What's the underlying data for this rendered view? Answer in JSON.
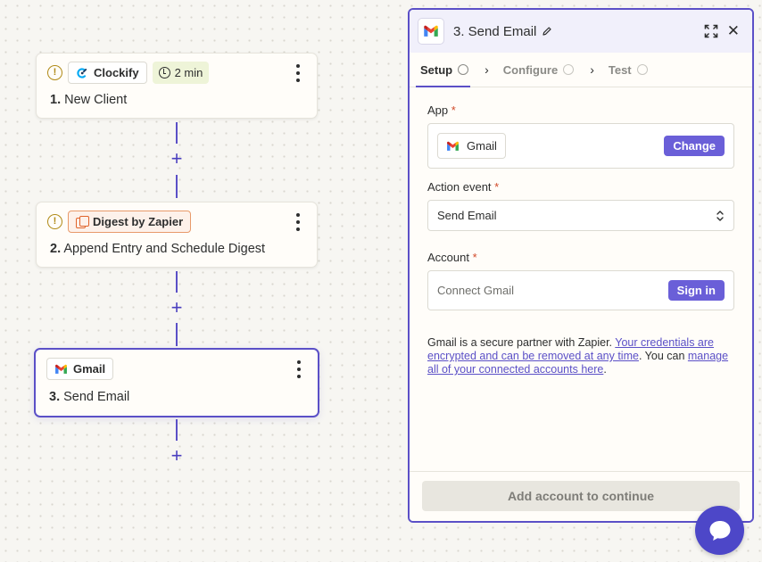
{
  "steps": [
    {
      "number": "1.",
      "title": "New Client",
      "app": "Clockify",
      "time_badge": "2 min"
    },
    {
      "number": "2.",
      "title": "Append Entry and Schedule Digest",
      "app": "Digest by Zapier"
    },
    {
      "number": "3.",
      "title": "Send Email",
      "app": "Gmail"
    }
  ],
  "panel": {
    "title": "3. Send Email",
    "tabs": [
      "Setup",
      "Configure",
      "Test"
    ],
    "app_label": "App",
    "app_name": "Gmail",
    "change_label": "Change",
    "action_label": "Action event",
    "action_value": "Send Email",
    "account_label": "Account",
    "account_placeholder": "Connect Gmail",
    "sign_in_label": "Sign in",
    "required_mark": "*",
    "info": {
      "prefix": "Gmail is a secure partner with Zapier. ",
      "link1": "Your credentials are encrypted and can be removed at any time",
      "middle": ". You can ",
      "link2": "manage all of your connected accounts here",
      "suffix": "."
    },
    "continue_label": "Add account to continue"
  },
  "colors": {
    "accent": "#5b50c7",
    "button": "#6a5fd8",
    "warning": "#b08a16",
    "digest_orange": "#e0642b"
  },
  "icons": {
    "warning": "exclamation-circle",
    "more": "kebab-menu",
    "chat": "chat-bubble"
  }
}
